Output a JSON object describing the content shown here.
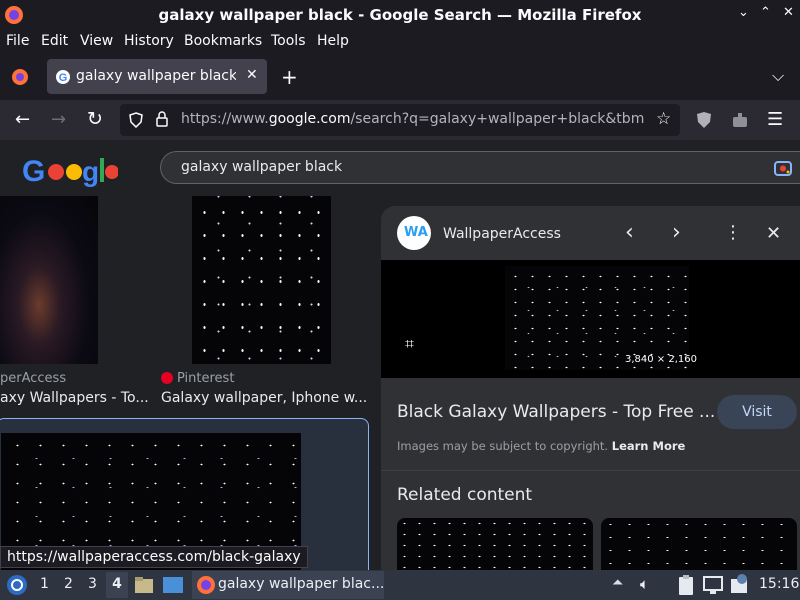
{
  "window": {
    "title": "galaxy wallpaper black - Google Search — Mozilla Firefox",
    "controls": [
      "minimize",
      "maximize",
      "close"
    ]
  },
  "menubar": {
    "items": [
      "File",
      "Edit",
      "View",
      "History",
      "Bookmarks",
      "Tools",
      "Help"
    ]
  },
  "tabs": [
    {
      "label": "galaxy wallpaper black - G",
      "favicon": "google-g-icon"
    }
  ],
  "newtab": "+",
  "nav": {
    "url_prefix": "https://www.",
    "url_domain": "google.com",
    "url_rest": "/search?q=galaxy+wallpaper+black&tbm"
  },
  "google": {
    "query": "galaxy wallpaper black"
  },
  "results": [
    {
      "source": "perAccess",
      "title": "axy Wallpapers - To..."
    },
    {
      "source": "Pinterest",
      "title": "Galaxy wallpaper, Iphone w..."
    }
  ],
  "panel": {
    "site": "WallpaperAccess",
    "site_initials": "WA",
    "dimensions": "3,840 × 2,160",
    "title": "Black Galaxy Wallpapers - Top Free ...",
    "visit": "Visit",
    "copyright": "Images may be subject to copyright.",
    "learn_more": "Learn More",
    "related": "Related content"
  },
  "status_url": "https://wallpaperaccess.com/black-galaxy",
  "taskbar": {
    "workspaces": [
      "1",
      "2",
      "3",
      "4"
    ],
    "active_workspace": "4",
    "window_label": "galaxy wallpaper blac...",
    "clock": "15:16"
  },
  "colors": {
    "accent": "#8ab4f8",
    "panel": "#303134",
    "chrome": "#1c1b22",
    "taskbar": "#2e3440"
  }
}
